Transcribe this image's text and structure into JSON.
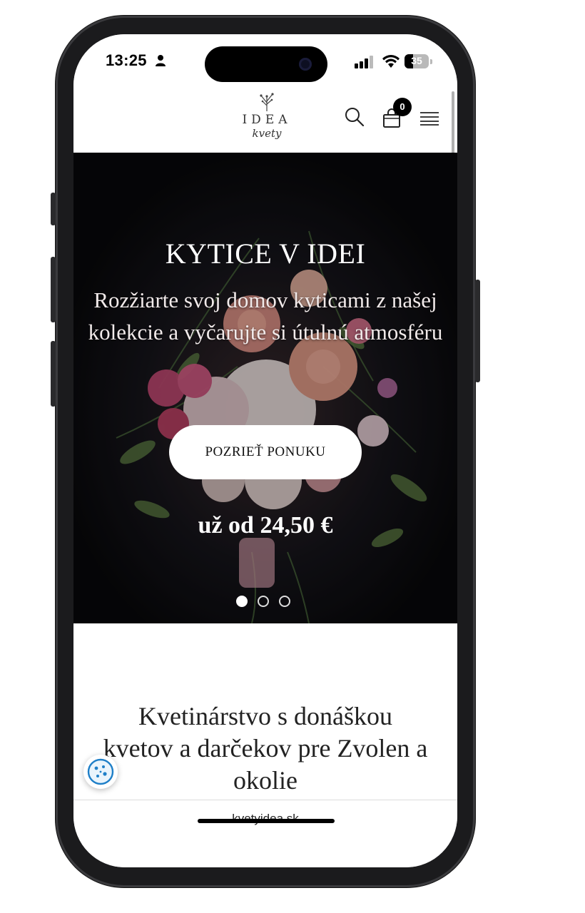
{
  "status_bar": {
    "time": "13:25",
    "battery": "35",
    "icons": [
      "person-icon",
      "signal-icon",
      "wifi-icon",
      "battery-icon"
    ]
  },
  "header": {
    "logo_main": "IDEA",
    "logo_script": "kvety",
    "cart_count": "0",
    "icons": [
      "search-icon",
      "cart-icon",
      "menu-icon"
    ]
  },
  "hero": {
    "title": "KYTICE V IDEI",
    "subtitle": "Rozžiarte svoj domov kyticami z našej kolekcie a vyčarujte si útulnú atmosféru",
    "cta_label": "POZRIEŤ PONUKU",
    "price": "už od 24,50 €",
    "slide_count": 3,
    "active_slide": 1
  },
  "about": {
    "title": "Kvetinárstvo s donáškou kvetov a darčekov pre Zvolen a okolie"
  },
  "browser": {
    "url": "kvetyidea.sk"
  },
  "colors": {
    "hero_bg": "#0b0b0d",
    "text_dark": "#222222",
    "white": "#ffffff"
  }
}
